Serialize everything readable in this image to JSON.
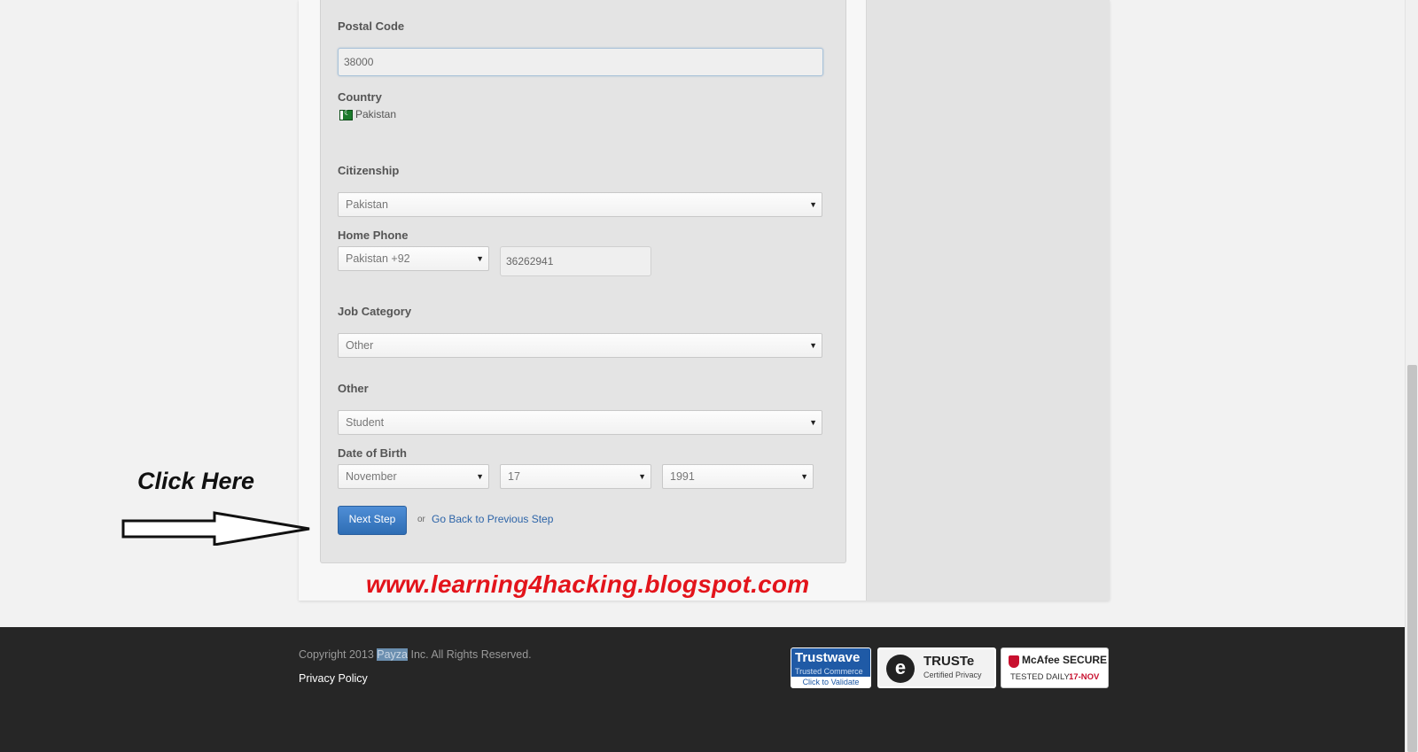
{
  "form": {
    "postal_code": {
      "label": "Postal Code",
      "value": "38000"
    },
    "country": {
      "label": "Country",
      "value": "Pakistan",
      "flag_icon": "pakistan-flag-icon"
    },
    "citizenship": {
      "label": "Citizenship",
      "selected": "Pakistan"
    },
    "home_phone": {
      "label": "Home Phone",
      "country_code": "Pakistan +92",
      "number": "36262941"
    },
    "job_category": {
      "label": "Job Category",
      "selected": "Other"
    },
    "other": {
      "label": "Other",
      "selected": "Student"
    },
    "date_of_birth": {
      "label": "Date of Birth",
      "month": "November",
      "day": "17",
      "year": "1991"
    },
    "next_button": "Next Step",
    "or_text": "or",
    "back_link": "Go Back to Previous Step"
  },
  "annotation": {
    "click_here": "Click Here",
    "watermark": "www.learning4hacking.blogspot.com"
  },
  "footer": {
    "copyright_prefix": "Copyright 2013 ",
    "copyright_brand": "Payza",
    "copyright_suffix": " Inc. All Rights Reserved.",
    "privacy_policy": "Privacy Policy",
    "badges": {
      "trustwave_title": "Trustwave",
      "trustwave_sub": "Trusted Commerce",
      "trustwave_cta": "Click to Validate",
      "truste_title": "TRUSTe",
      "truste_sub": "Certified Privacy",
      "mcafee_title": "McAfee SECURE",
      "mcafee_tested": "TESTED DAILY",
      "mcafee_date": "17-NOV"
    }
  },
  "colors": {
    "primary_button": "#3a7bc8",
    "link": "#2d64a8",
    "watermark": "#e3141b",
    "footer_bg": "#262626"
  }
}
